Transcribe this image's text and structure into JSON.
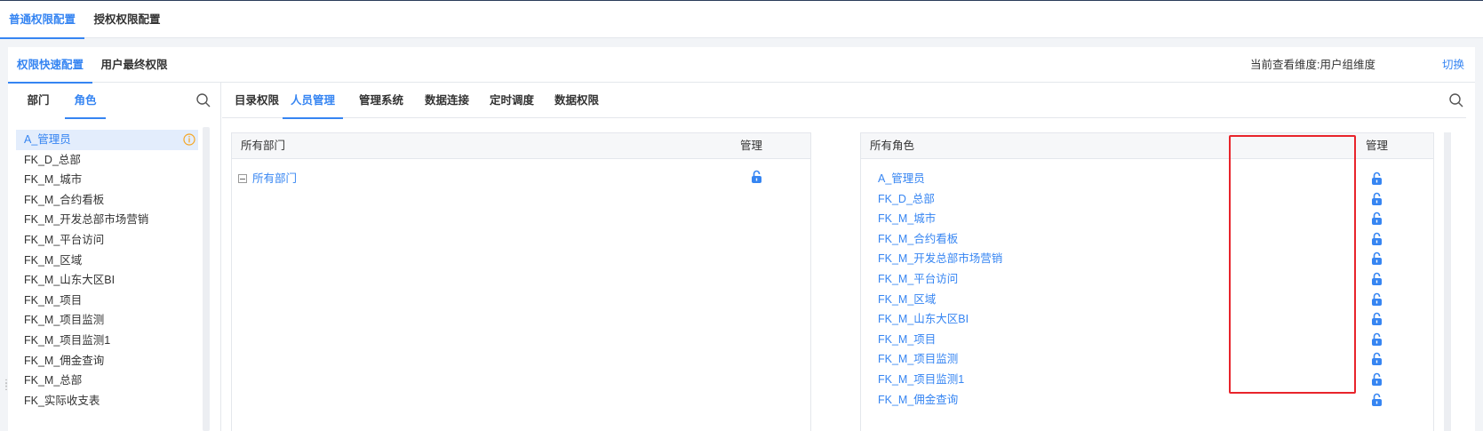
{
  "top_tabs": [
    "普通权限配置",
    "授权权限配置"
  ],
  "sub_tabs": [
    "权限快速配置",
    "用户最终权限"
  ],
  "dimension_text": "当前查看维度:用户组维度",
  "switch_label": "切换",
  "left_tabs": [
    "部门",
    "角色"
  ],
  "roles": [
    "A_管理员",
    "FK_D_总部",
    "FK_M_城市",
    "FK_M_合约看板",
    "FK_M_开发总部市场营销",
    "FK_M_平台访问",
    "FK_M_区域",
    "FK_M_山东大区BI",
    "FK_M_项目",
    "FK_M_项目监测",
    "FK_M_项目监测1",
    "FK_M_佣金查询",
    "FK_M_总部",
    "FK_实际收支表"
  ],
  "right_tabs": [
    "目录权限",
    "人员管理",
    "管理系统",
    "数据连接",
    "定时调度",
    "数据权限"
  ],
  "dept_panel": {
    "header": "所有部门",
    "manage": "管理",
    "root": "所有部门"
  },
  "role_panel": {
    "header": "所有角色",
    "manage": "管理",
    "items": [
      "A_管理员",
      "FK_D_总部",
      "FK_M_城市",
      "FK_M_合约看板",
      "FK_M_开发总部市场营销",
      "FK_M_平台访问",
      "FK_M_区域",
      "FK_M_山东大区BI",
      "FK_M_项目",
      "FK_M_项目监测",
      "FK_M_项目监测1",
      "FK_M_佣金查询"
    ]
  },
  "colors": {
    "accent": "#3685f2",
    "highlight": "#e8242b",
    "info": "#f5a623"
  },
  "icons": [
    "search-icon",
    "info-icon",
    "unlock-icon",
    "collapse-icon"
  ]
}
